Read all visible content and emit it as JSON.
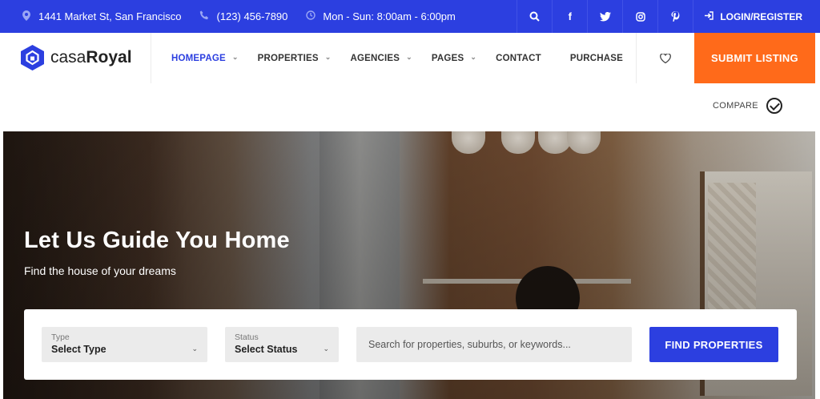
{
  "topbar": {
    "address": "1441 Market St, San Francisco",
    "phone": "(123) 456-7890",
    "hours": "Mon - Sun: 8:00am - 6:00pm",
    "login_label": "LOGIN/REGISTER",
    "social": [
      "search-icon",
      "facebook-icon",
      "twitter-icon",
      "instagram-icon",
      "pinterest-icon"
    ]
  },
  "header": {
    "logo_light": "casa",
    "logo_bold": "Royal",
    "nav": [
      {
        "label": "HOMEPAGE",
        "active": true,
        "dropdown": true
      },
      {
        "label": "PROPERTIES",
        "dropdown": true
      },
      {
        "label": "AGENCIES",
        "dropdown": true
      },
      {
        "label": "PAGES",
        "dropdown": true
      },
      {
        "label": "CONTACT",
        "dropdown": false
      },
      {
        "label": "PURCHASE",
        "dropdown": false
      }
    ],
    "submit_label": "SUBMIT LISTING"
  },
  "compare": {
    "label": "COMPARE"
  },
  "hero": {
    "title": "Let Us Guide You Home",
    "subtitle": "Find the house of your dreams"
  },
  "search": {
    "type_label": "Type",
    "type_value": "Select Type",
    "status_label": "Status",
    "status_value": "Select Status",
    "keywords_placeholder": "Search for properties, suburbs, or keywords...",
    "button_label": "FIND PROPERTIES"
  },
  "colors": {
    "brand": "#2c3fe0",
    "accent": "#ff6a1a"
  }
}
